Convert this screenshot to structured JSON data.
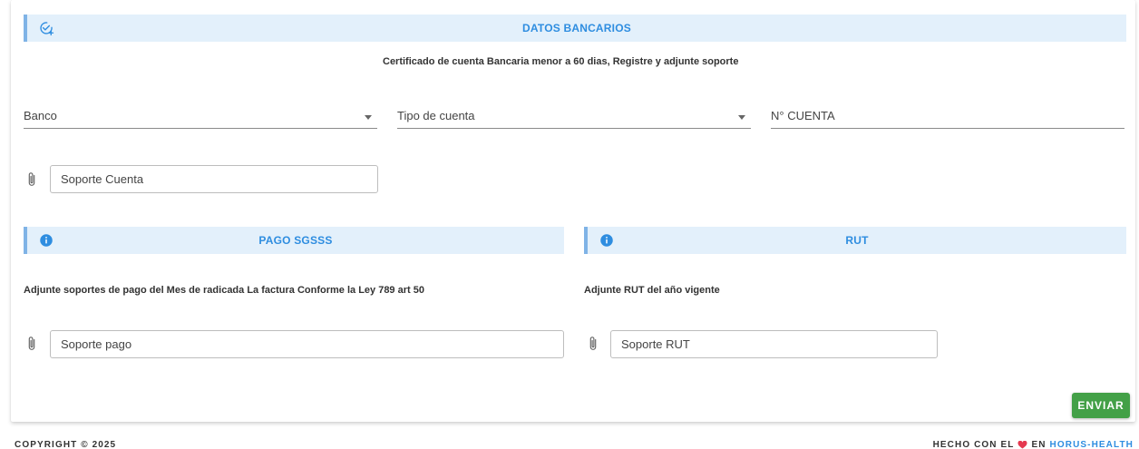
{
  "datos_bancarios": {
    "title": "DATOS BANCARIOS",
    "icon": "calendar-check-plus-icon",
    "subtitle": "Certificado de cuenta Bancaria menor a 60 dias, Registre y adjunte soporte"
  },
  "fields": {
    "banco": "Banco",
    "tipo_cuenta": "Tipo de cuenta",
    "numero_cuenta": "N° CUENTA",
    "soporte_cuenta": "Soporte Cuenta"
  },
  "pago_sgsss": {
    "title": "PAGO SGSSS",
    "subtitle": "Adjunte soportes de pago del Mes de radicada La factura Conforme la Ley 789 art 50",
    "file_label": "Soporte pago"
  },
  "rut": {
    "title": "RUT",
    "subtitle": "Adjunte RUT del año vigente",
    "file_label": "Soporte RUT"
  },
  "actions": {
    "submit": "ENVIAR"
  },
  "footer": {
    "copyright": "COPYRIGHT © 2025",
    "made_with_prefix": "HECHO CON EL",
    "made_with_middle": "EN",
    "brand": "HORUS-HEALTH"
  },
  "colors": {
    "accent": "#2e8de0",
    "banner_bg": "#e3f0fb",
    "submit": "#43a047",
    "heart": "#e53950"
  }
}
